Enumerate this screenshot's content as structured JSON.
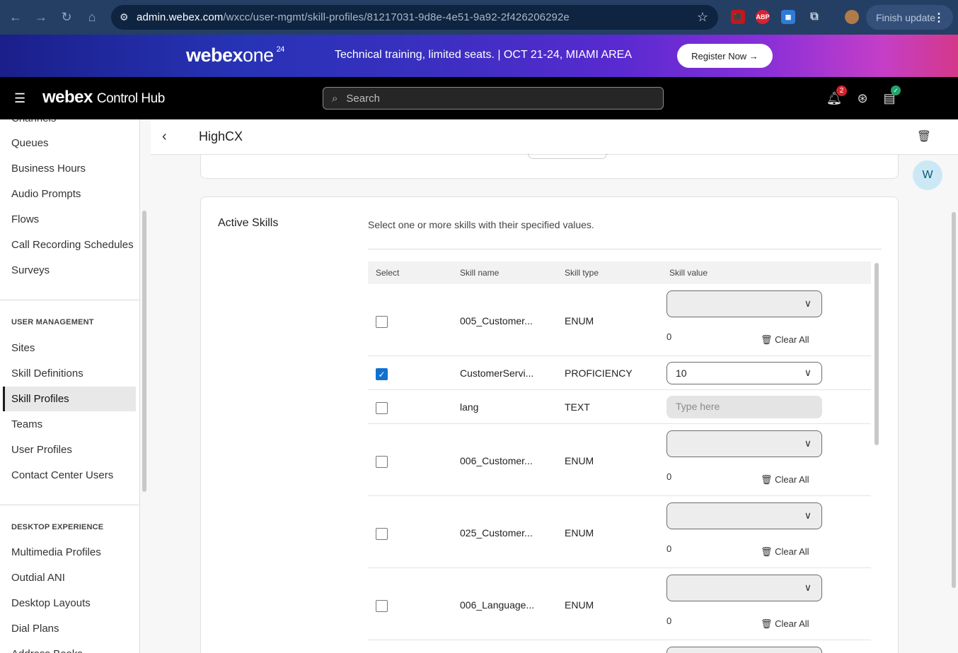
{
  "browser": {
    "url_host": "admin.webex.com",
    "url_path": "/wxcc/user-mgmt/skill-profiles/81217031-9d8e-4e51-9a92-2f426206292e",
    "finish_update": "Finish update",
    "extensions": [
      "pdf-icon",
      "abp-icon",
      "translate-icon",
      "puzzle-icon"
    ]
  },
  "banner": {
    "logo_main": "webex",
    "logo_one": "one",
    "logo_sup": "24",
    "message": "Technical training, limited seats. | OCT 21-24, MIAMI AREA",
    "cta": "Register Now →"
  },
  "appbar": {
    "brand": "webex",
    "product": "Control Hub",
    "search_placeholder": "Search",
    "notification_count": "2",
    "avatar_initial": "W"
  },
  "sidebar": {
    "items_top": [
      {
        "label": "Channels"
      },
      {
        "label": "Queues"
      },
      {
        "label": "Business Hours"
      },
      {
        "label": "Audio Prompts"
      },
      {
        "label": "Flows"
      },
      {
        "label": "Call Recording Schedules"
      },
      {
        "label": "Surveys"
      }
    ],
    "section_user": "USER MANAGEMENT",
    "items_user": [
      {
        "label": "Sites"
      },
      {
        "label": "Skill Definitions"
      },
      {
        "label": "Skill Profiles"
      },
      {
        "label": "Teams"
      },
      {
        "label": "User Profiles"
      },
      {
        "label": "Contact Center Users"
      }
    ],
    "section_desktop": "DESKTOP EXPERIENCE",
    "items_desktop": [
      {
        "label": "Multimedia Profiles"
      },
      {
        "label": "Outdial ANI"
      },
      {
        "label": "Desktop Layouts"
      },
      {
        "label": "Dial Plans"
      },
      {
        "label": "Address Books"
      }
    ]
  },
  "page": {
    "title": "HighCX"
  },
  "active_skills": {
    "heading": "Active Skills",
    "description": "Select one or more skills with their specified values.",
    "columns": [
      "Select",
      "Skill name",
      "Skill type",
      "Skill value"
    ],
    "clear_all": "Clear All",
    "rows": [
      {
        "name": "005_Customer...",
        "type": "ENUM",
        "checked": false,
        "kind": "enum",
        "count": "0"
      },
      {
        "name": "CustomerServi...",
        "type": "PROFICIENCY",
        "checked": true,
        "kind": "proficiency",
        "value": "10"
      },
      {
        "name": "lang",
        "type": "TEXT",
        "checked": false,
        "kind": "text",
        "placeholder": "Type here"
      },
      {
        "name": "006_Customer...",
        "type": "ENUM",
        "checked": false,
        "kind": "enum",
        "count": "0"
      },
      {
        "name": "025_Customer...",
        "type": "ENUM",
        "checked": false,
        "kind": "enum",
        "count": "0"
      },
      {
        "name": "006_Language...",
        "type": "ENUM",
        "checked": false,
        "kind": "enum",
        "count": "0"
      }
    ]
  }
}
